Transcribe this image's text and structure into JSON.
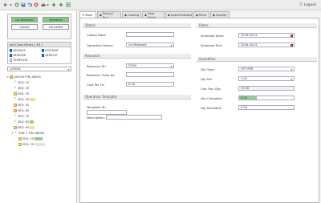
{
  "toolbar": {
    "logout_label": "Logout"
  },
  "status": {
    "unreleased": "Un-Released",
    "released": "Released",
    "closed": "Closed",
    "cancelled": "Cancelled"
  },
  "filters": {
    "title": "Job Class Filters ( 83 )",
    "items": [
      {
        "label": "DEFAULT",
        "checked": true
      },
      {
        "label": "FIRSTART",
        "checked": true
      },
      {
        "label": "REWORK",
        "checked": true
      },
      {
        "label": "SERVICE",
        "checked": true
      },
      {
        "label": "TEMPLATE",
        "checked": false
      }
    ]
  },
  "job_select": "J-00034",
  "tree": [
    {
      "text": "J-00034  P/N: A8000",
      "kind": "job"
    },
    {
      "text": "SEQ: 10",
      "kind": "done",
      "progress": 0
    },
    {
      "text": "SEQ: 20",
      "kind": "done",
      "progress": 0
    },
    {
      "text": "SEQ: 30",
      "kind": "box",
      "progress": 0
    },
    {
      "text": "SEQ: 40",
      "kind": "done",
      "progress": 0.6
    },
    {
      "text": "SEQ: 50",
      "kind": "box",
      "progress": 0
    },
    {
      "text": "SEQ: 60",
      "kind": "box",
      "progress": 0
    },
    {
      "text": "SEQ: 70",
      "kind": "done",
      "progress": 0
    },
    {
      "text": "SEQ: 80",
      "kind": "done",
      "progress": 0.4
    },
    {
      "text": "SEQ: 90",
      "kind": "box",
      "progress": 0.5
    },
    {
      "text": "SUB: 1  P/N: A8000",
      "kind": "sub"
    },
    {
      "text": "SEQ: 10",
      "kind": "box",
      "progress": 0.7
    },
    {
      "text": "SEQ: 20",
      "kind": "box",
      "progress": 0.9
    }
  ],
  "tabs": [
    "Main",
    "Setup / Run",
    "Costing",
    "User Fields",
    "Specifications",
    "Parts",
    "Quality"
  ],
  "status_section": {
    "title": "Status",
    "closed_date_label": "Closed Date:",
    "closed_date": "",
    "op_status_label": "Operation Status:",
    "op_status": "Un-Released"
  },
  "resource_section": {
    "title": "Resource",
    "resource_id_label": "Resource ID :",
    "resource_id": "STON",
    "resource_class_label": "Resource Class ID:",
    "resource_class": "",
    "cost_label": "Cost Per Hr:",
    "cost": "0.00"
  },
  "template_section": {
    "title": "Operation Template",
    "template_label": "Template ID:",
    "template": "",
    "description_label": "Description:",
    "description": ""
  },
  "dates_section": {
    "title": "Dates",
    "start_label": "Schedule Start:",
    "start": "2016-04-01",
    "end_label": "Schedule End:",
    "end": "2016-04-01"
  },
  "quantities_section": {
    "title": "Quantities",
    "qty_type_label": "Qty Type:",
    "qty_type": "QTY PER",
    "qty_per_label": "Qty Per:",
    "qty_per": "1.00",
    "calc_run_label": "Calc Run Qty:",
    "calc_run": "17.00",
    "complete_label": "Qty Complete:",
    "complete": "5.00",
    "deviated_label": "Qty Deviated:",
    "deviated": "0.00"
  }
}
